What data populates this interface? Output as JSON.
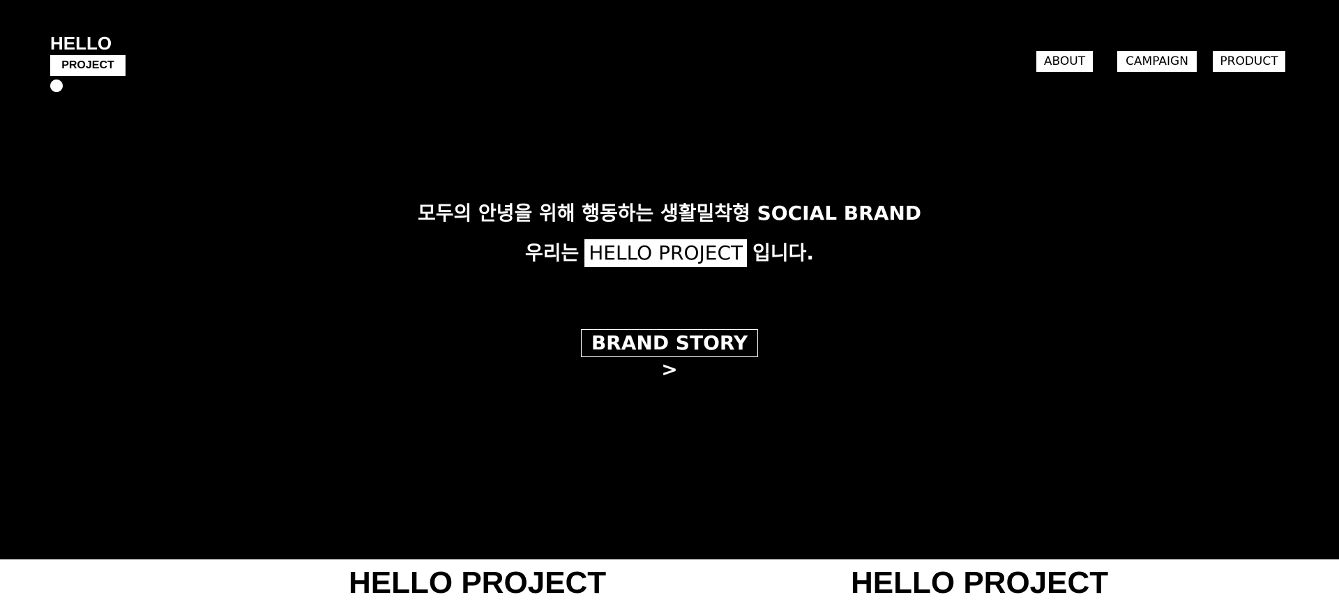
{
  "logo": {
    "line1": "HELLO",
    "line2": "PROJECT"
  },
  "nav": {
    "items": [
      {
        "label": "ABOUT"
      },
      {
        "label": "CAMPAIGN"
      },
      {
        "label": "PRODUCT"
      }
    ]
  },
  "hero": {
    "tagline_line1": "모두의 안녕을 위해 행동하는 생활밀착형 SOCIAL BRAND",
    "tagline_line2_prefix": "우리는",
    "tagline_line2_highlight": "HELLO PROJECT",
    "tagline_line2_suffix": "입니다.",
    "cta_label": "BRAND STORY >"
  },
  "marquee": {
    "items": [
      "HELLO PROJECT",
      "HELLO PROJECT"
    ]
  },
  "colors": {
    "background": "#000000",
    "foreground": "#ffffff"
  }
}
